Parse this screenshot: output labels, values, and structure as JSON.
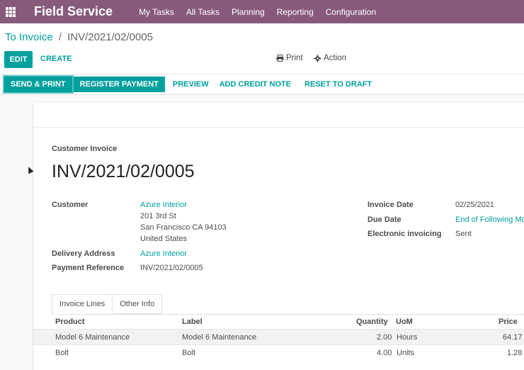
{
  "navbar": {
    "brand": "Field Service",
    "menu": [
      "My Tasks",
      "All Tasks",
      "Planning",
      "Reporting",
      "Configuration"
    ]
  },
  "breadcrumb": {
    "parent": "To Invoice",
    "separator": "/",
    "current": "INV/2021/02/0005"
  },
  "toolbar": {
    "edit_label": "EDIT",
    "create_label": "CREATE",
    "print_label": "Print",
    "action_label": "Action"
  },
  "statusbar": {
    "send_print": "SEND & PRINT",
    "register_payment": "REGISTER PAYMENT",
    "preview": "PREVIEW",
    "add_credit_note": "ADD CREDIT NOTE",
    "reset_to_draft": "RESET TO DRAFT"
  },
  "invoice": {
    "type_label": "Customer Invoice",
    "number": "INV/2021/02/0005",
    "customer_label": "Customer",
    "customer_name": "Azure Interior",
    "address_line1": "201 3rd St",
    "address_line2": "San Francisco CA 94103",
    "address_line3": "United States",
    "delivery_label": "Delivery Address",
    "delivery_value": "Azure Interior",
    "payment_ref_label": "Payment Reference",
    "payment_ref_value": "INV/2021/02/0005",
    "invoice_date_label": "Invoice Date",
    "invoice_date_value": "02/25/2021",
    "due_date_label": "Due Date",
    "due_date_value": "End of Following Mo",
    "einvoicing_label": "Electronic invoicing",
    "einvoicing_value": "Sent"
  },
  "tabs": [
    "Invoice Lines",
    "Other Info"
  ],
  "lines": {
    "headers": {
      "product": "Product",
      "label": "Label",
      "quantity": "Quantity",
      "uom": "UoM",
      "price": "Price"
    },
    "rows": [
      {
        "product": "Model 6 Maintenance",
        "label": "Model 6 Maintenance",
        "quantity": "2.00",
        "uom": "Hours",
        "price": "64.17"
      },
      {
        "product": "Bolt",
        "label": "Bolt",
        "quantity": "4.00",
        "uom": "Units",
        "price": "1.28"
      }
    ]
  },
  "icons": {
    "apps": "apps-grid-icon",
    "print": "printer-icon",
    "action": "gear-icon"
  },
  "colors": {
    "navbar": "#875a7b",
    "accent": "#00a09d"
  }
}
